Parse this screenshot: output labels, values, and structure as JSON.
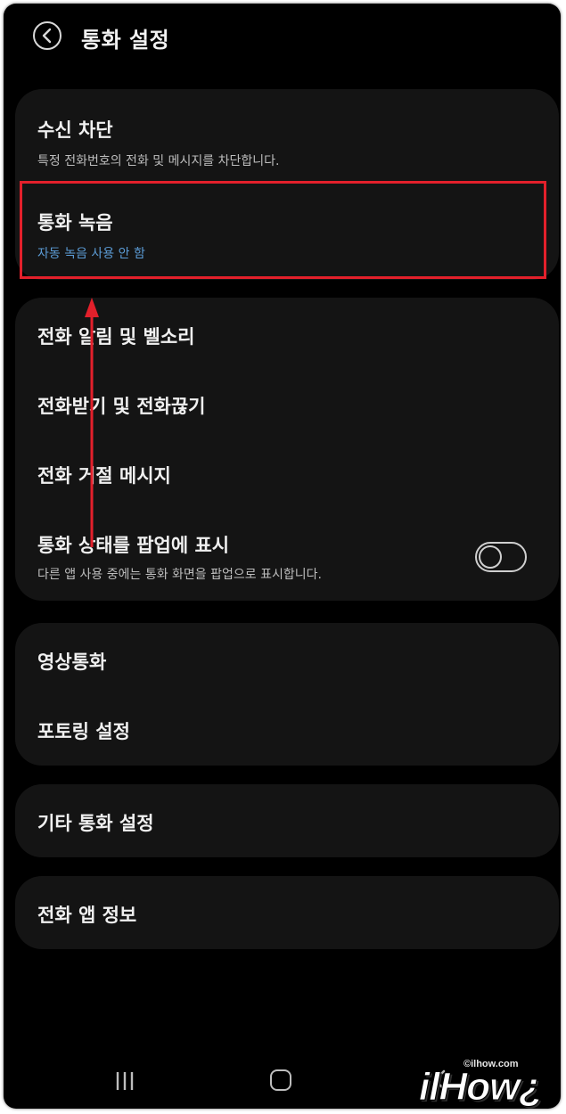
{
  "header": {
    "title": "통화 설정"
  },
  "sections": [
    {
      "items": [
        {
          "title": "수신 차단",
          "subtitle": "특정 전화번호의 전화 및 메시지를 차단합니다."
        },
        {
          "title": "통화 녹음",
          "subtitle": "자동 녹음 사용 안 함"
        }
      ]
    },
    {
      "items": [
        {
          "title": "전화 알림 및 벨소리"
        },
        {
          "title": "전화받기 및 전화끊기"
        },
        {
          "title": "전화 거절 메시지"
        },
        {
          "title": "통화 상태를 팝업에 표시",
          "subtitle": "다른 앱 사용 중에는 통화 화면을 팝업으로 표시합니다.",
          "toggle": "off"
        }
      ]
    },
    {
      "items": [
        {
          "title": "영상통화"
        },
        {
          "title": "포토링 설정"
        }
      ]
    },
    {
      "items": [
        {
          "title": "기타 통화 설정"
        }
      ]
    },
    {
      "items": [
        {
          "title": "전화 앱 정보"
        }
      ]
    }
  ],
  "watermark": {
    "url": "©ilhow.com",
    "brand": "ilHow¿"
  },
  "colors": {
    "background": "#000000",
    "card": "#141414",
    "accent_blue": "#5b9bd5",
    "highlight_red": "#e3202b"
  },
  "icons": [
    "back-arrow-icon",
    "recent-apps-icon",
    "home-icon",
    "nav-back-icon"
  ]
}
